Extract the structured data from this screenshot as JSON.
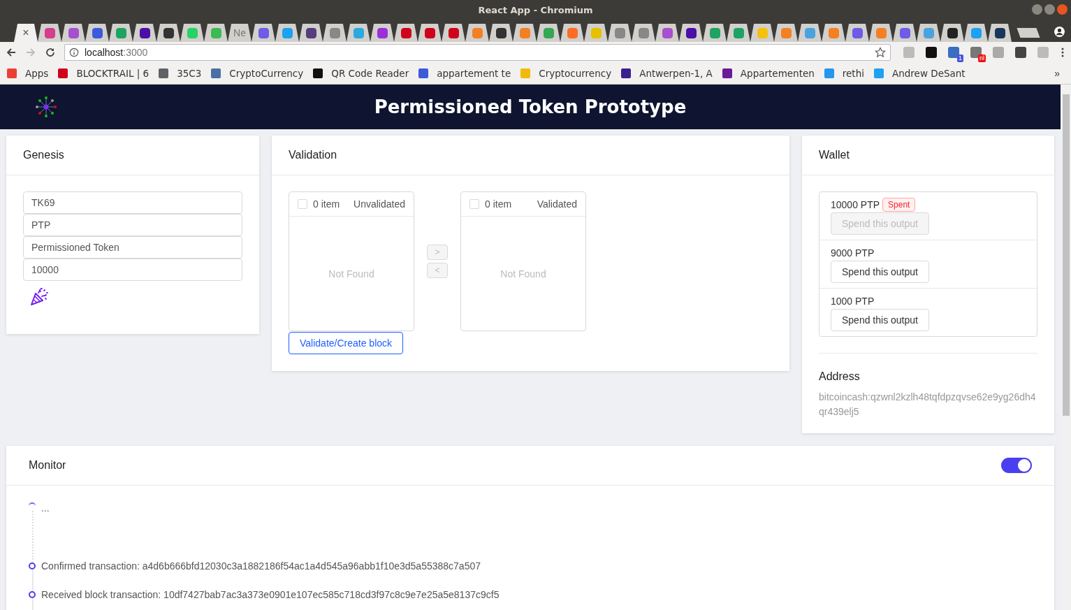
{
  "window": {
    "title": "React App - Chromium"
  },
  "tabs": [
    {
      "selected": true,
      "close": "×"
    },
    {
      "selected": false,
      "color": "#d43f8d"
    },
    {
      "selected": false,
      "color": "#a84fd0"
    },
    {
      "selected": false,
      "color": "#3b5bdb"
    },
    {
      "selected": false,
      "color": "#1ea362"
    },
    {
      "selected": false,
      "color": "#4b0fa8"
    },
    {
      "selected": false,
      "color": "#333333"
    },
    {
      "selected": false,
      "color": "#25d366"
    },
    {
      "selected": false,
      "color": "#3cba54"
    },
    {
      "selected": false,
      "label": "Ne"
    },
    {
      "selected": false,
      "color": "#6c5ce7"
    },
    {
      "selected": false,
      "color": "#1da1f2"
    },
    {
      "selected": false,
      "color": "#563d7c"
    },
    {
      "selected": false,
      "color": "#888888"
    },
    {
      "selected": false,
      "color": "#29a9e0"
    },
    {
      "selected": false,
      "color": "#9b30d9"
    },
    {
      "selected": false,
      "color": "#d0021b"
    },
    {
      "selected": false,
      "color": "#d0021b"
    },
    {
      "selected": false,
      "color": "#d0021b"
    },
    {
      "selected": false,
      "color": "#f48024"
    },
    {
      "selected": false,
      "color": "#333333"
    },
    {
      "selected": false,
      "color": "#f48024"
    },
    {
      "selected": false,
      "color": "#34a853"
    },
    {
      "selected": false,
      "color": "#fc6d26"
    },
    {
      "selected": false,
      "color": "#e5c100"
    },
    {
      "selected": false,
      "color": "#888888"
    },
    {
      "selected": false,
      "color": "#888888"
    },
    {
      "selected": false,
      "color": "#a84fd0"
    },
    {
      "selected": false,
      "color": "#4b0fa8"
    },
    {
      "selected": false,
      "color": "#1ea362"
    },
    {
      "selected": false,
      "color": "#1ea362"
    },
    {
      "selected": false,
      "color": "#f4c20d"
    },
    {
      "selected": false,
      "color": "#f48024"
    },
    {
      "selected": false,
      "color": "#4aa3df"
    },
    {
      "selected": false,
      "color": "#f48024"
    },
    {
      "selected": false,
      "color": "#6c5ce7"
    },
    {
      "selected": false,
      "color": "#f48024"
    },
    {
      "selected": false,
      "color": "#6c5ce7"
    },
    {
      "selected": false,
      "color": "#4aa3df"
    },
    {
      "selected": false,
      "color": "#222222"
    },
    {
      "selected": false,
      "color": "#1da1f2"
    },
    {
      "selected": false,
      "color": "#1b365d"
    }
  ],
  "address": {
    "host": "localhost",
    "port": ":3000"
  },
  "extensions": [
    {
      "color": "#bbbbbb"
    },
    {
      "color": "#111111"
    },
    {
      "color": "#3b6ec2",
      "badge": "1"
    },
    {
      "color": "#777777",
      "badge": "nl"
    },
    {
      "color": "#aaaaaa"
    },
    {
      "color": "#444444"
    },
    {
      "color": "#bbbbbb"
    }
  ],
  "bookmarks": [
    {
      "label": "Apps",
      "color": "#e94235"
    },
    {
      "label": "BLOCKTRAIL | 6",
      "color": "#d0021b"
    },
    {
      "label": "35C3",
      "color": "#5f6368"
    },
    {
      "label": "CryptoCurrency",
      "color": "#4a6fa5"
    },
    {
      "label": "QR Code Reader",
      "color": "#111111"
    },
    {
      "label": "appartement te",
      "color": "#3b5bdb"
    },
    {
      "label": "Cryptocurrency",
      "color": "#f0b90b"
    },
    {
      "label": "Antwerpen-1, A",
      "color": "#3b1f8f"
    },
    {
      "label": "Appartementen",
      "color": "#6a1b9a"
    },
    {
      "label": "rethi",
      "color": "#2496ed"
    },
    {
      "label": "Andrew DeSant",
      "color": "#1da1f2"
    }
  ],
  "bookmarks_more": "»",
  "header": {
    "title": "Permissioned Token Prototype"
  },
  "genesis": {
    "title": "Genesis",
    "fields": [
      "TK69",
      "PTP",
      "Permissioned Token",
      "10000"
    ]
  },
  "validation": {
    "title": "Validation",
    "lists": [
      {
        "checked": false,
        "count": "0 item",
        "title": "Unvalidated",
        "empty": "Not Found"
      },
      {
        "checked": false,
        "count": "0 item",
        "title": "Validated",
        "empty": "Not Found"
      }
    ],
    "moves": [
      {
        "label": ">",
        "disabled": true
      },
      {
        "label": "<",
        "disabled": true
      }
    ],
    "button": "Validate/Create block"
  },
  "wallet": {
    "title": "Wallet",
    "outputs": [
      {
        "amount": "10000 PTP",
        "tag": "Spent",
        "button": "Spend this output",
        "disabled": true
      },
      {
        "amount": "9000 PTP",
        "button": "Spend this output",
        "disabled": false
      },
      {
        "amount": "1000 PTP",
        "button": "Spend this output",
        "disabled": false
      }
    ],
    "address_title": "Address",
    "address": "bitcoincash:qzwnl2kzlh48tqfdpzqvse62e9yg26dh4qr439elj5"
  },
  "monitor": {
    "title": "Monitor",
    "on": true,
    "events": [
      {
        "kind": "pending",
        "text": "..."
      },
      {
        "kind": "done",
        "text": "Confirmed transaction: a4d6b666bfd12030c3a1882186f54ac1a4d545a96abb1f10e3d5a55388c7a507"
      },
      {
        "kind": "done",
        "text": "Received block transaction: 10df7427bab7ac3a373e0901e107ec585c718cd3f97c8c9e7e25a5e8137c9cf5"
      }
    ]
  }
}
